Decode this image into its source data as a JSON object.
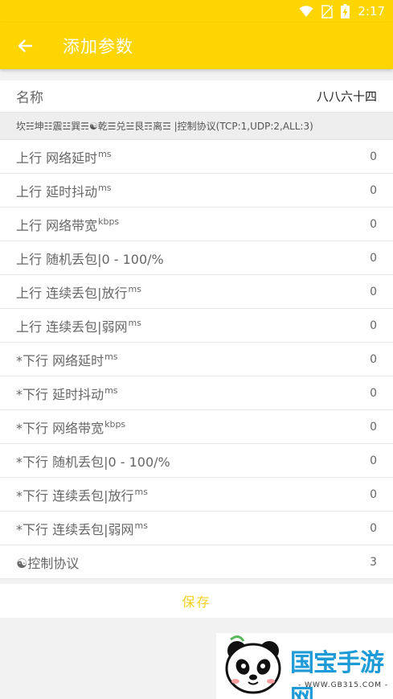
{
  "status_bar": {
    "time": "2:17"
  },
  "app_bar": {
    "title": "添加参数"
  },
  "name_field": {
    "label": "名称",
    "value": "八八六十四"
  },
  "hint": "坎☵坤☷震☳巽☴☯乾☰兑☱艮☶离☲ |控制协议(TCP:1,UDP:2,ALL:3)",
  "params": [
    {
      "label": "上行 网络延时",
      "unit": "ms",
      "value": "0"
    },
    {
      "label": "上行 延时抖动",
      "unit": "ms",
      "value": "0"
    },
    {
      "label": "上行 网络带宽",
      "unit": "kbps",
      "value": "0"
    },
    {
      "label": "上行 随机丢包|0 - 100/%",
      "unit": "",
      "value": "0"
    },
    {
      "label": "上行 连续丢包|放行",
      "unit": "ms",
      "value": "0"
    },
    {
      "label": "上行 连续丢包|弱网",
      "unit": "ms",
      "value": "0"
    },
    {
      "label": "*下行 网络延时",
      "unit": "ms",
      "value": "0"
    },
    {
      "label": "*下行 延时抖动",
      "unit": "ms",
      "value": "0"
    },
    {
      "label": "*下行 网络带宽",
      "unit": "kbps",
      "value": "0"
    },
    {
      "label": "*下行 随机丢包|0 - 100/%",
      "unit": "",
      "value": "0"
    },
    {
      "label": "*下行 连续丢包|放行",
      "unit": "ms",
      "value": "0"
    },
    {
      "label": "*下行 连续丢包|弱网",
      "unit": "ms",
      "value": "0"
    },
    {
      "label": "☯控制协议",
      "unit": "",
      "value": "3"
    }
  ],
  "save_label": "保存",
  "watermark": {
    "brand": "国宝手游网",
    "url": "- WWW.GB315.COM -"
  },
  "colors": {
    "accent": "#fdd500",
    "save_text": "#f3cf21",
    "brand_blue": "#1e9ad6"
  }
}
